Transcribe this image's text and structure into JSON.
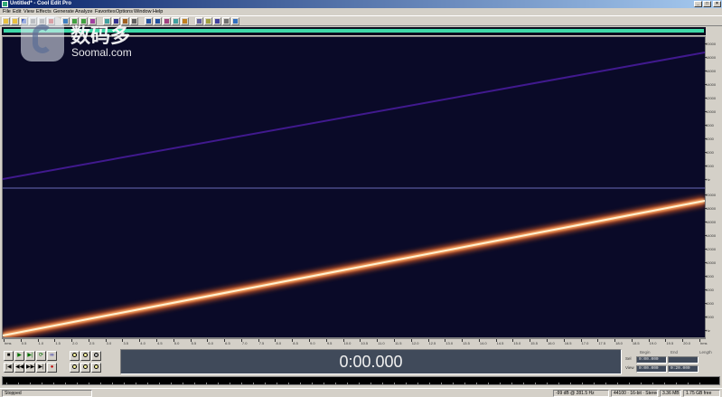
{
  "window": {
    "title": "Untitled* - Cool Edit Pro",
    "minimize_glyph": "_",
    "maximize_glyph": "□",
    "close_glyph": "×"
  },
  "menu": {
    "items": [
      "File",
      "Edit",
      "View",
      "Effects",
      "Generate",
      "Analyze",
      "Favorites",
      "Options",
      "Window",
      "Help"
    ]
  },
  "toolbar": {
    "button_icons": [
      "new-file-icon",
      "open-file-icon",
      "save-icon",
      "undo-icon",
      "redo-icon",
      "cut-icon",
      "copy-icon",
      "paste-icon",
      "paste-new-icon",
      "mix-paste-icon",
      "waveform-view-icon",
      "spectral-view-icon",
      "multitrack-icon",
      "edit-view-icon",
      "select-tool-icon",
      "hybrid-tool-icon",
      "envelope-icon",
      "loop-icon",
      "cue-icon",
      "properties-icon",
      "metronome-icon",
      "cd-icon",
      "settings-icon",
      "help-icon"
    ]
  },
  "colors": {
    "overview_bar": "#3fd9a8",
    "spectral_bg": "#0a0a28",
    "sweep_core": "#ffe9b0",
    "sweep_glow": "#ff7a30",
    "harmonic": "#4a1ca0",
    "divider": "#6a6ab8",
    "time_display_bg": "#404a5a"
  },
  "spectral": {
    "channel_divider": "stereo"
  },
  "vertical_scale": {
    "labels": [
      "20000",
      "18000",
      "16000",
      "14000",
      "12000",
      "10000",
      "8000",
      "6000",
      "4000",
      "2000",
      "Hz",
      "20000",
      "18000",
      "16000",
      "14000",
      "12000",
      "10000",
      "8000",
      "6000",
      "4000",
      "2000",
      "Hz"
    ]
  },
  "horizontal_ruler": {
    "labels": [
      "hms",
      "0.5",
      "1.0",
      "1.5",
      "2.0",
      "2.5",
      "3.0",
      "3.5",
      "4.0",
      "4.5",
      "5.0",
      "5.5",
      "6.0",
      "6.5",
      "7.0",
      "7.5",
      "8.0",
      "8.5",
      "9.0",
      "9.5",
      "10.0",
      "10.5",
      "11.0",
      "11.5",
      "12.0",
      "12.5",
      "13.0",
      "13.5",
      "14.0",
      "14.5",
      "15.0",
      "15.5",
      "16.0",
      "16.5",
      "17.0",
      "17.5",
      "18.0",
      "18.5",
      "19.0",
      "19.5",
      "20.0",
      "hms"
    ]
  },
  "transport": {
    "buttons": [
      {
        "glyph": "■",
        "name": "stop-button",
        "tone": ""
      },
      {
        "glyph": "▶",
        "name": "play-button",
        "tone": "green"
      },
      {
        "glyph": "▶|",
        "name": "play-to-end-button",
        "tone": "green"
      },
      {
        "glyph": "⟳",
        "name": "play-looped-button",
        "tone": "green"
      },
      {
        "glyph": "∞",
        "name": "play-loop-mode-button",
        "tone": "blue"
      },
      {
        "glyph": "|◀",
        "name": "go-to-start-button",
        "tone": ""
      },
      {
        "glyph": "◀◀",
        "name": "rewind-button",
        "tone": ""
      },
      {
        "glyph": "▶▶",
        "name": "fast-forward-button",
        "tone": ""
      },
      {
        "glyph": "▶|",
        "name": "go-to-end-button",
        "tone": ""
      },
      {
        "glyph": "●",
        "name": "record-button",
        "tone": "red"
      }
    ]
  },
  "zoom": {
    "buttons": [
      "zoom-in-horizontal-icon",
      "zoom-out-horizontal-icon",
      "zoom-full-icon",
      "zoom-in-vertical-icon",
      "zoom-out-vertical-icon",
      "zoom-selection-icon"
    ]
  },
  "time_display": {
    "value": "0:00.000"
  },
  "selection": {
    "header_begin": "Begin",
    "header_end": "End",
    "header_length": "Length",
    "sel_label": "Sel",
    "view_label": "View",
    "sel_begin": "0:00.000",
    "sel_end": "",
    "view_begin": "0:00.000",
    "view_end": "0:20.000"
  },
  "status": {
    "left": "Stopped",
    "cells": [
      "-99 dB @  281.5 Hz",
      "44100 · 16-bit · Stereo",
      "3.36 MB",
      "1.75 GB free"
    ]
  },
  "watermark": {
    "chinese": "数码多",
    "english": "Soomal.com"
  }
}
